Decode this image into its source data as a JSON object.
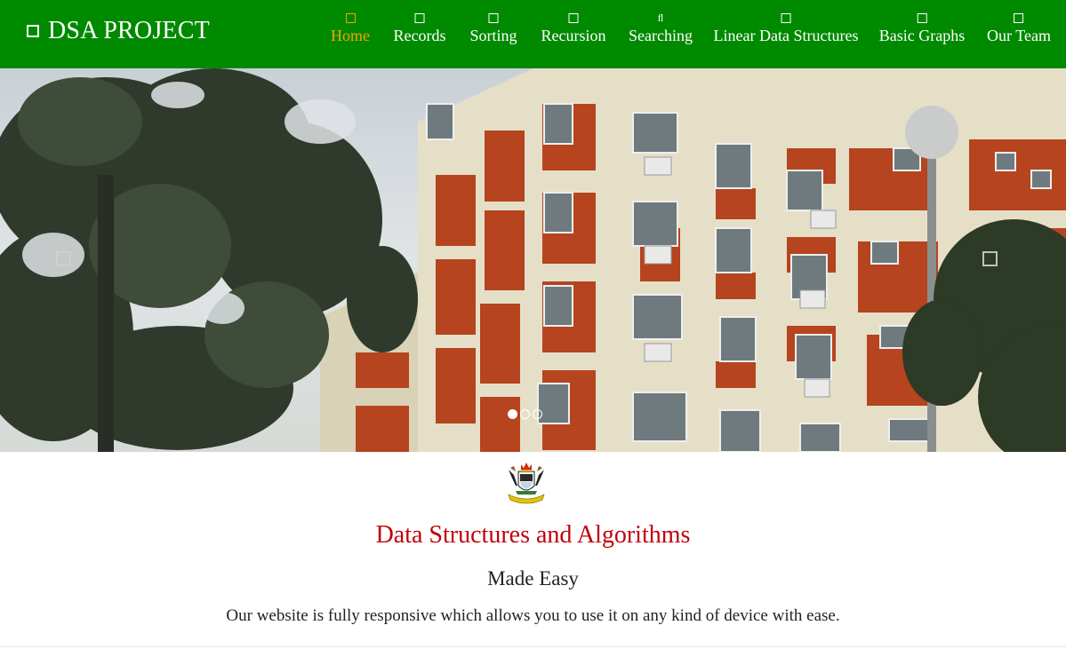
{
  "brand": {
    "label": "DSA PROJECT",
    "icon": "square-icon"
  },
  "nav": {
    "items": [
      {
        "label": "Home",
        "icon": "square-icon",
        "active": true
      },
      {
        "label": "Records",
        "icon": "square-icon"
      },
      {
        "label": "Sorting",
        "icon": "square-icon"
      },
      {
        "label": "Recursion",
        "icon": "square-icon"
      },
      {
        "label": "Searching",
        "icon": "fl-glyph-icon",
        "glyph": "ﬂ"
      },
      {
        "label": "Linear Data Structures",
        "icon": "square-icon"
      },
      {
        "label": "Basic Graphs",
        "icon": "square-icon"
      },
      {
        "label": "Our Team",
        "icon": "square-icon"
      }
    ],
    "colors": {
      "bar": "#008a00",
      "text": "#ffffff",
      "active": "#f2a20a"
    }
  },
  "carousel": {
    "slides": 3,
    "active_slide": 1,
    "image": "university-building-photo"
  },
  "main": {
    "crest": "university-crest-logo",
    "title": "Data Structures and Algorithms",
    "subtitle": "Made Easy",
    "description": "Our website is fully responsive which allows you to use it on any kind of device with ease.",
    "colors": {
      "title": "#c0000b"
    }
  }
}
